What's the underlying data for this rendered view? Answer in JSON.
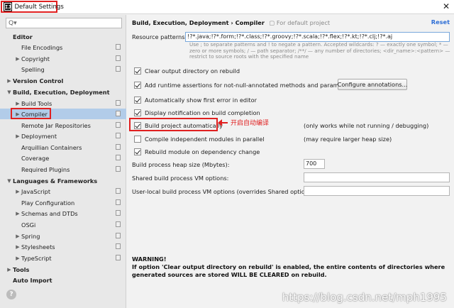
{
  "window": {
    "title": "Default Settings",
    "app_icon": "IJ"
  },
  "sidebar": {
    "search_glyph": "Q▾",
    "items": [
      {
        "label": "Editor",
        "level": 0,
        "bold": true,
        "arrow": ""
      },
      {
        "label": "File Encodings",
        "level": 1,
        "copy": true
      },
      {
        "label": "Copyright",
        "level": 1,
        "arrow": "▶",
        "copy": true
      },
      {
        "label": "Spelling",
        "level": 1,
        "copy": true
      },
      {
        "label": "Version Control",
        "level": 0,
        "bold": true,
        "arrow": "▶"
      },
      {
        "label": "Build, Execution, Deployment",
        "level": 0,
        "bold": true,
        "arrow": "▼"
      },
      {
        "label": "Build Tools",
        "level": 1,
        "arrow": "▶",
        "copy": true
      },
      {
        "label": "Compiler",
        "level": 1,
        "arrow": "▶",
        "copy": true,
        "selected": true
      },
      {
        "label": "Remote Jar Repositories",
        "level": 1,
        "copy": true
      },
      {
        "label": "Deployment",
        "level": 1,
        "arrow": "▶",
        "copy": true
      },
      {
        "label": "Arquillian Containers",
        "level": 1,
        "copy": true
      },
      {
        "label": "Coverage",
        "level": 1,
        "copy": true
      },
      {
        "label": "Required Plugins",
        "level": 1,
        "copy": true
      },
      {
        "label": "Languages & Frameworks",
        "level": 0,
        "bold": true,
        "arrow": "▼"
      },
      {
        "label": "JavaScript",
        "level": 1,
        "arrow": "▶",
        "copy": true
      },
      {
        "label": "Play Configuration",
        "level": 1,
        "copy": true
      },
      {
        "label": "Schemas and DTDs",
        "level": 1,
        "arrow": "▶",
        "copy": true
      },
      {
        "label": "OSGi",
        "level": 1,
        "copy": true
      },
      {
        "label": "Spring",
        "level": 1,
        "arrow": "▶",
        "copy": true
      },
      {
        "label": "Stylesheets",
        "level": 1,
        "arrow": "▶",
        "copy": true
      },
      {
        "label": "TypeScript",
        "level": 1,
        "arrow": "▶",
        "copy": true
      },
      {
        "label": "Tools",
        "level": 0,
        "bold": true,
        "arrow": "▶"
      },
      {
        "label": "Auto Import",
        "level": 0,
        "bold": true,
        "arrow": ""
      }
    ],
    "help": "?"
  },
  "main": {
    "breadcrumb": "Build, Execution, Deployment › Compiler",
    "breadcrumb_sub": "For default project",
    "reset": "Reset",
    "resource_label": "Resource patterns:",
    "resource_value": "!?*.java;!?*.form;!?*.class;!?*.groovy;!?*.scala;!?*.flex;!?*.kt;!?*.clj;!?*.aj",
    "resource_hint": "Use ; to separate patterns and ! to negate a pattern. Accepted wildcards: ? — exactly one symbol; * — zero or more symbols; / — path separator; /**/ — any number of directories; <dir_name>:<pattern> — restrict to source roots with the specified name",
    "options": [
      {
        "label": "Clear output directory on rebuild",
        "checked": true
      },
      {
        "label": "Add runtime assertions for not-null-annotated methods and parameters",
        "checked": true
      },
      {
        "label": "Automatically show first error in editor",
        "checked": true
      },
      {
        "label": "Display notification on build completion",
        "checked": true
      },
      {
        "label": "Build project automatically",
        "checked": true,
        "note": "(only works while not running / debugging)"
      },
      {
        "label": "Compile independent modules in parallel",
        "checked": false,
        "note": "(may require larger heap size)"
      },
      {
        "label": "Rebuild module on dependency change",
        "checked": true
      }
    ],
    "configure_button": "Configure annotations...",
    "annotation_text": "开启自动编译",
    "heap_label": "Build process heap size (Mbytes):",
    "heap_value": "700",
    "shared_vm_label": "Shared build process VM options:",
    "shared_vm_value": "",
    "user_vm_label": "User-local build process VM options (overrides Shared options):",
    "user_vm_value": "",
    "warning_title": "WARNING!",
    "warning_body": "If option 'Clear output directory on rebuild' is enabled, the entire contents of directories where generated sources are stored WILL BE CLEARED on rebuild."
  },
  "watermark": "https://blog.csdn.net/mph1995",
  "colors": {
    "accent": "#2f6fd6",
    "highlight": "#e02020",
    "selection": "#b2cce9"
  }
}
